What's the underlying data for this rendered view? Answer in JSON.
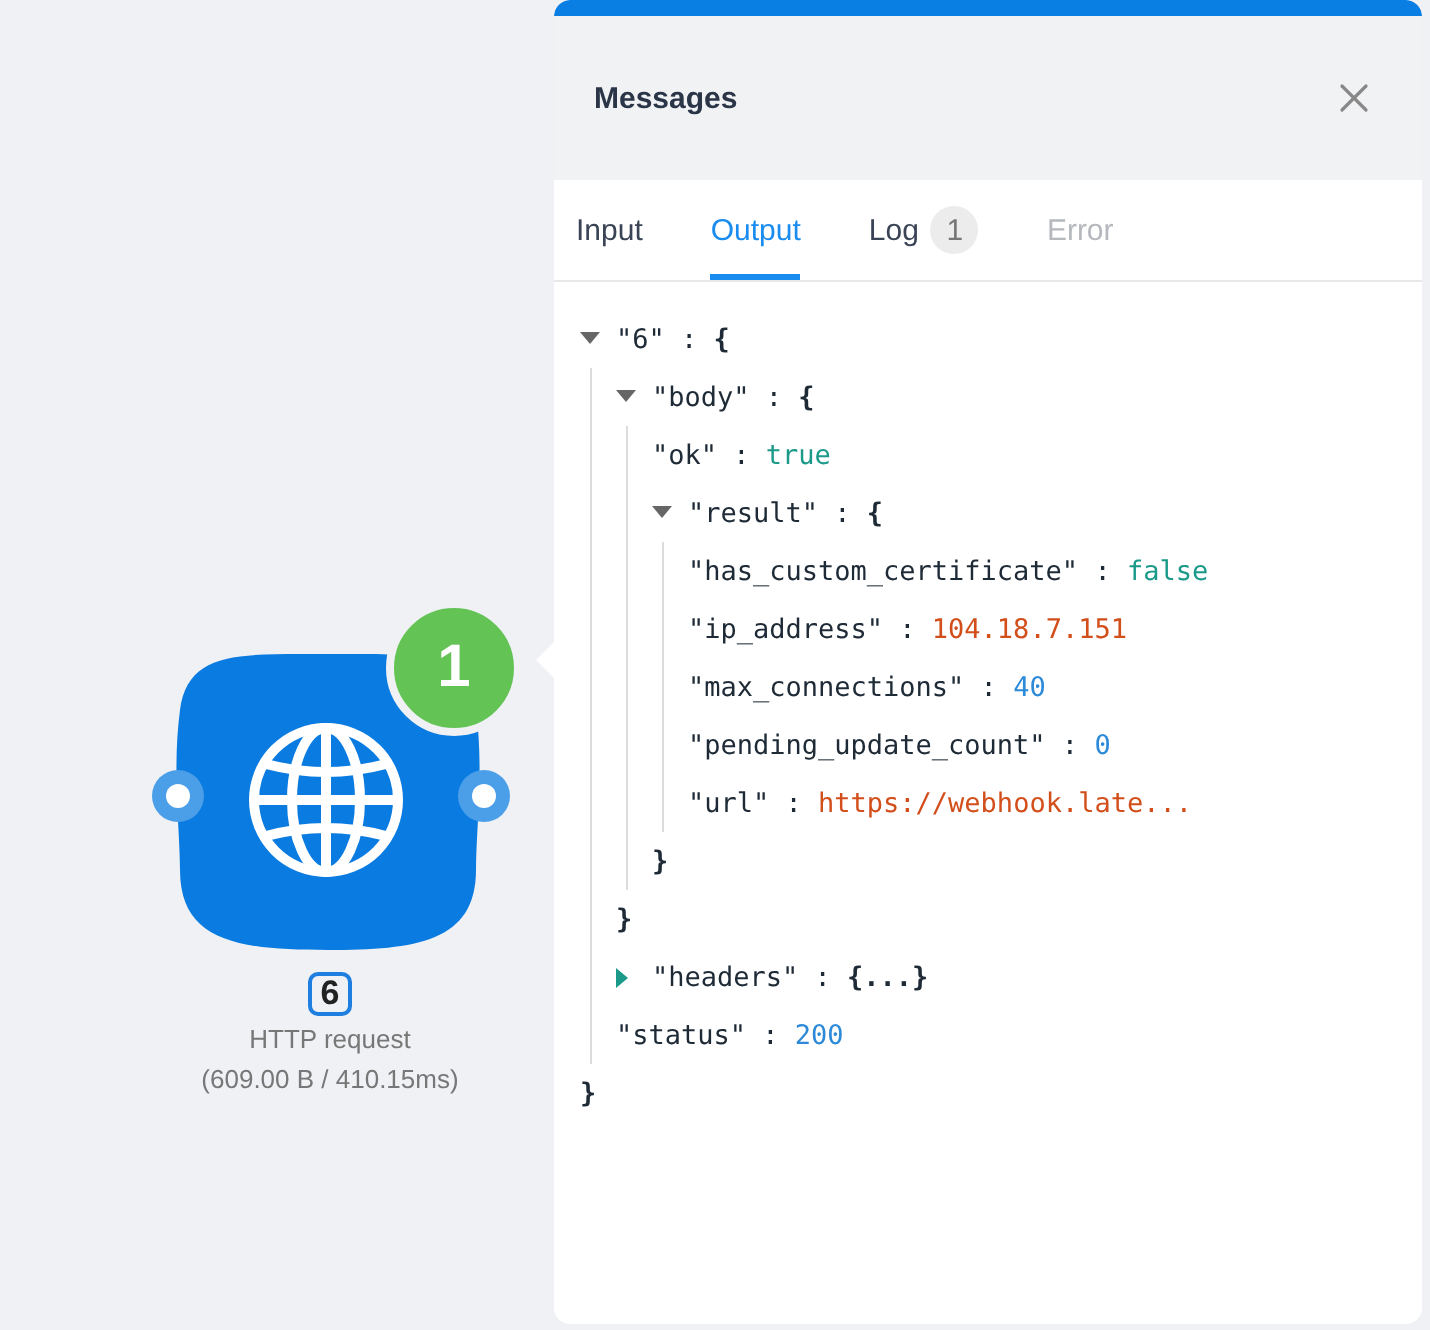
{
  "canvas": {
    "node": {
      "badge": "1",
      "id_label": "6",
      "title": "HTTP request",
      "stats": "(609.00 B / 410.15ms)"
    }
  },
  "panel": {
    "title": "Messages",
    "tabs": [
      {
        "label": "Input",
        "selected": false,
        "disabled": false
      },
      {
        "label": "Output",
        "selected": true,
        "disabled": false
      },
      {
        "label": "Log",
        "count": "1",
        "selected": false,
        "disabled": false
      },
      {
        "label": "Error",
        "selected": false,
        "disabled": true
      }
    ],
    "tree": [
      {
        "key": "\"6\" :",
        "kind": "object",
        "value": "{",
        "close": "}",
        "expanded": true,
        "children": [
          {
            "key": "\"body\" :",
            "kind": "object",
            "value": "{",
            "close": "}",
            "expanded": true,
            "children": [
              {
                "key": "\"ok\" :",
                "kind": "boolean",
                "value": "true"
              },
              {
                "key": "\"result\" :",
                "kind": "object",
                "value": "{",
                "close": "}",
                "expanded": true,
                "children": [
                  {
                    "key": "\"has_custom_certificate\" :",
                    "kind": "boolean",
                    "value": "false"
                  },
                  {
                    "key": "\"ip_address\" :",
                    "kind": "string",
                    "value": "104.18.7.151"
                  },
                  {
                    "key": "\"max_connections\" :",
                    "kind": "number",
                    "value": "40"
                  },
                  {
                    "key": "\"pending_update_count\" :",
                    "kind": "number",
                    "value": "0"
                  },
                  {
                    "key": "\"url\" :",
                    "kind": "string",
                    "value": "https://webhook.late..."
                  }
                ]
              }
            ]
          },
          {
            "key": "\"headers\" :",
            "kind": "object",
            "value": "{...}",
            "expanded": false
          },
          {
            "key": "\"status\" :",
            "kind": "number",
            "value": "200"
          }
        ]
      }
    ]
  }
}
